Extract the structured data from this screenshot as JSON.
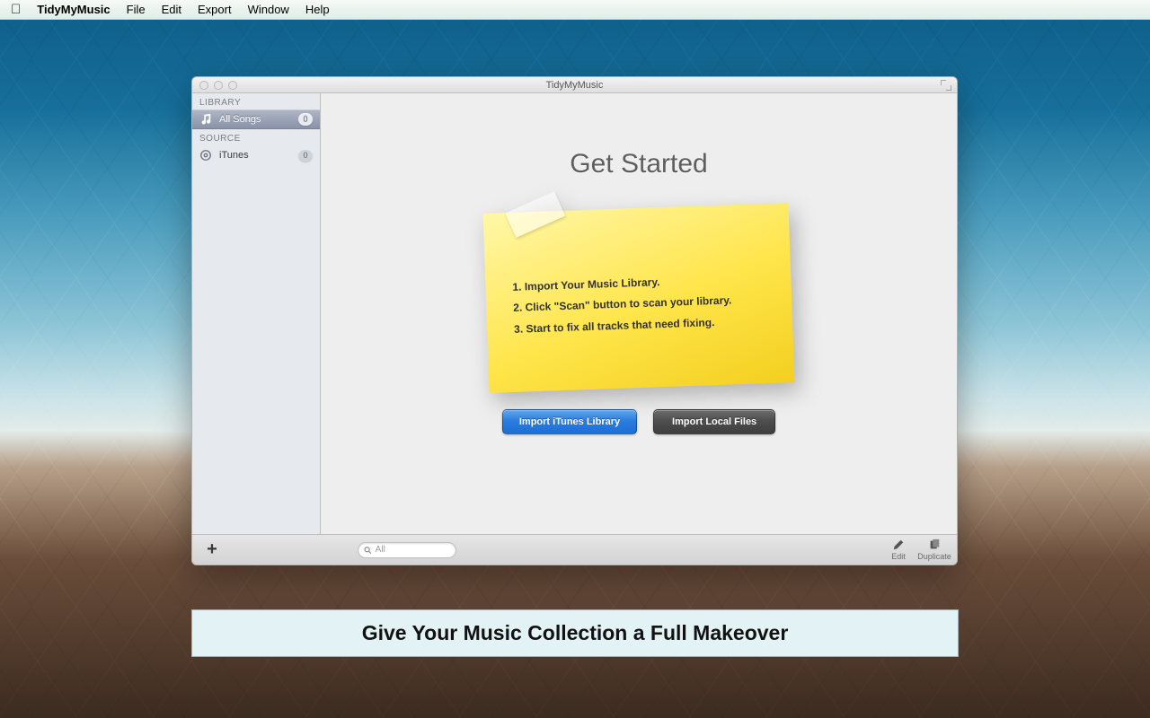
{
  "menubar": {
    "app_title": "TidyMyMusic",
    "items": [
      "File",
      "Edit",
      "Export",
      "Window",
      "Help"
    ]
  },
  "window": {
    "title": "TidyMyMusic",
    "sidebar": {
      "sections": {
        "library_label": "LIBRARY",
        "source_label": "SOURCE"
      },
      "all_songs": {
        "label": "All Songs",
        "count": "0"
      },
      "itunes": {
        "label": "iTunes",
        "count": "0"
      }
    },
    "main": {
      "heading": "Get Started",
      "steps": [
        "1. Import Your Music Library.",
        "2. Click \"Scan\" button to scan your library.",
        "3. Start to fix all tracks that need fixing."
      ],
      "import_itunes_label": "Import iTunes Library",
      "import_local_label": "Import Local Files"
    },
    "toolbar": {
      "search_placeholder": "All",
      "edit_label": "Edit",
      "duplicate_label": "Duplicate"
    }
  },
  "caption": "Give Your Music Collection a Full Makeover"
}
